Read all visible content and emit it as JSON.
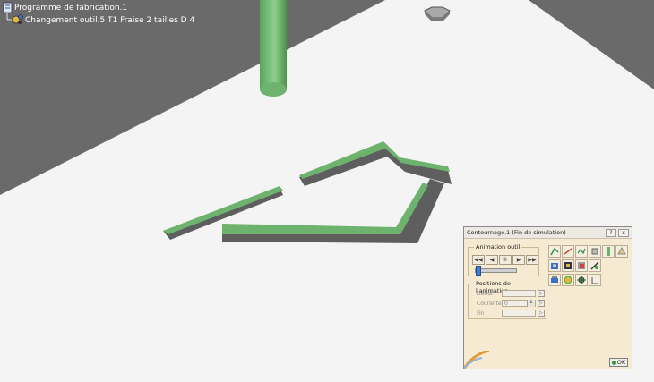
{
  "tree": {
    "items": [
      {
        "label": "Programme de fabrication.1",
        "icon": "program-icon"
      },
      {
        "label": "Changement outil.5  T1 Fraise 2 tailles D 4",
        "icon": "tool-change-icon"
      }
    ]
  },
  "dialog": {
    "title": "Contournage.1 (Fin de simulation)",
    "title_buttons": [
      "?",
      "x"
    ],
    "animation_group": {
      "legend": "Animation outil",
      "buttons": [
        {
          "icon": "rewind-to-start-icon",
          "glyph": "◀◀"
        },
        {
          "icon": "step-back-icon",
          "glyph": "◀"
        },
        {
          "icon": "pause-icon",
          "glyph": "II"
        },
        {
          "icon": "play-forward-icon",
          "glyph": "▶"
        },
        {
          "icon": "fast-forward-icon",
          "glyph": "▶▶"
        }
      ]
    },
    "positions_group": {
      "legend": "Positions de l'animation",
      "debut_label": "Début",
      "courante_label": "Courante",
      "courante_value": "0",
      "fin_label": "Fin"
    },
    "ok_label": "OK"
  },
  "colors": {
    "viewport_dark": "#6b6b6b",
    "part_surface": "#f4f4f4",
    "tool_green": "#6db36d",
    "dialog_bg": "#f7ead2"
  }
}
